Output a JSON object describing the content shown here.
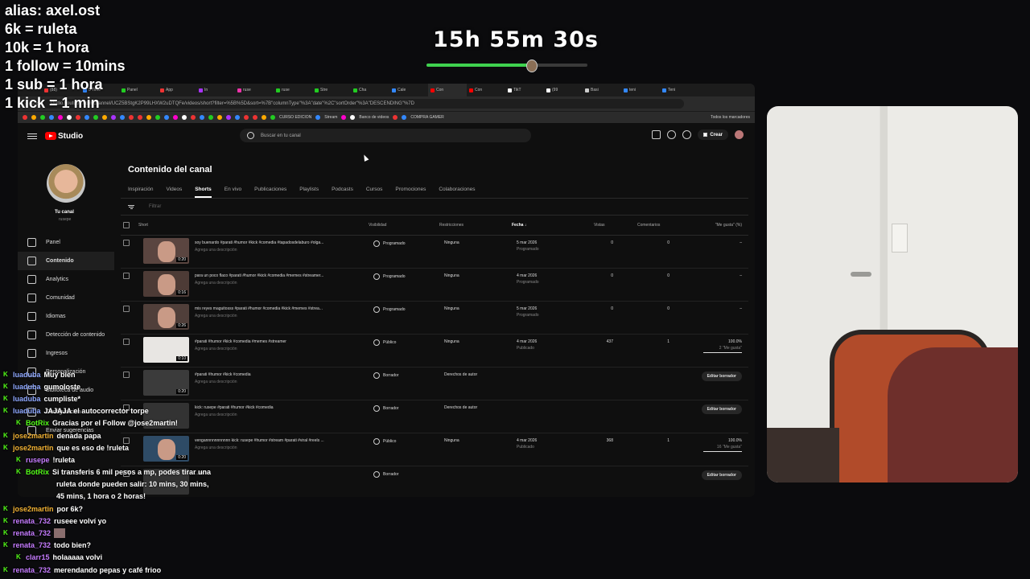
{
  "overlay": {
    "lines": [
      "alias: axel.ost",
      "6k =  ruleta",
      "10k = 1 hora",
      "1 follow = 10mins",
      "1 sub = 1 hora",
      "1 kick = 1 min"
    ],
    "timer": "15h 55m 30s",
    "timer_progress": 0.65
  },
  "browser": {
    "url": "studio.youtube.com/channel/UCZ5BStgK2P99LHXW2uDTQFe/videos/short?filter=%5B%5D&sort=%7B\"columnType\"%3A\"date\"%2C\"sortOrder\"%3A\"DESCENDING\"%7D",
    "tabs": [
      "(88)",
      "5 Time",
      "Panel",
      "App",
      "In",
      "ruse",
      "ruse",
      "Stre",
      "Cha",
      "Cale",
      "Con",
      "Con",
      "TikT",
      "(99",
      "Basi",
      "teni",
      "Teni"
    ],
    "bookmarks": [
      "CURSO EDICION",
      "Stream",
      "Banco de videos",
      "COMPRA GAMER",
      "Todos los marcadores"
    ]
  },
  "studio": {
    "brand": "Studio",
    "search_placeholder": "Buscar en tu canal",
    "create_label": "Crear",
    "channel_label": "Tu canal",
    "channel_handle": "rusepe",
    "nav": [
      "Panel",
      "Contenido",
      "Analytics",
      "Comunidad",
      "Idiomas",
      "Detección de contenido",
      "Ingresos",
      "Personalización",
      "Biblioteca de audio"
    ],
    "nav_bottom": [
      "Configuración",
      "Enviar sugerencias"
    ],
    "page_title": "Contenido del canal",
    "tabs": [
      "Inspiración",
      "Videos",
      "Shorts",
      "En vivo",
      "Publicaciones",
      "Playlists",
      "Podcasts",
      "Cursos",
      "Promociones",
      "Colaboraciones"
    ],
    "filter_placeholder": "Filtrar",
    "columns": {
      "short": "Short",
      "visibility": "Visibilidad",
      "restrictions": "Restricciones",
      "date": "Fecha",
      "views": "Vistas",
      "comments": "Comentarios",
      "likes": "\"Me gusta\" (%)"
    },
    "rows": [
      {
        "title": "soy buenardo #parati #humor #kick #comedia #tapadosdelaburo #olga...",
        "desc": "Agrega una descripción",
        "duration": "0:20",
        "visibility": "Programado",
        "restrictions": "Ninguna",
        "date": "5 mar 2026",
        "date_sub": "Programado",
        "views": "0",
        "comments": "0",
        "likes": "–",
        "likes_sub": ""
      },
      {
        "title": "para un poco flaco #parati #humor #kick #comedia #memes #streamer...",
        "desc": "Agrega una descripción",
        "duration": "0:16",
        "visibility": "Programado",
        "restrictions": "Ninguna",
        "date": "4 mar 2026",
        "date_sub": "Programado",
        "views": "0",
        "comments": "0",
        "likes": "–",
        "likes_sub": ""
      },
      {
        "title": "mis reyes maguitosss #parati #humor #comedia #kick #memes #strea...",
        "desc": "Agrega una descripción",
        "duration": "0:26",
        "visibility": "Programado",
        "restrictions": "Ninguna",
        "date": "5 mar 2026",
        "date_sub": "Programado",
        "views": "0",
        "comments": "0",
        "likes": "–",
        "likes_sub": ""
      },
      {
        "title": "#parati #humor #kick #comedia #memes #streamer",
        "desc": "Agrega una descripción",
        "duration": "0:10",
        "visibility": "Público",
        "restrictions": "Ninguna",
        "date": "4 mar 2026",
        "date_sub": "Publicado",
        "views": "437",
        "comments": "1",
        "likes": "100.0%",
        "likes_sub": "2 \"Me gusta\""
      },
      {
        "title": "#parati #humor #kick #comedia",
        "desc": "Agrega una descripción",
        "duration": "0:20",
        "visibility": "Borrador",
        "restrictions": "Derechos de autor",
        "date": "",
        "date_sub": "",
        "views": "",
        "comments": "",
        "likes": "",
        "likes_sub": "",
        "edit": "Editar borrador"
      },
      {
        "title": "kick: rusepe #parati #humor #kick #comedia",
        "desc": "Agrega una descripción",
        "duration": "",
        "visibility": "Borrador",
        "restrictions": "Derechos de autor",
        "date": "",
        "date_sub": "",
        "views": "",
        "comments": "",
        "likes": "",
        "likes_sub": "",
        "edit": "Editar borrador"
      },
      {
        "title": "vengannnnnnnnnnn kick: rusepe #humor #stream #parati #viral #reels ...",
        "desc": "Agrega una descripción",
        "duration": "0:20",
        "visibility": "Público",
        "restrictions": "Ninguna",
        "date": "4 mar 2026",
        "date_sub": "Publicado",
        "views": "368",
        "comments": "1",
        "likes": "100.0%",
        "likes_sub": "16 \"Me gusta\""
      },
      {
        "title": "...zle",
        "desc": "",
        "duration": "",
        "visibility": "Borrador",
        "restrictions": "",
        "date": "",
        "date_sub": "",
        "views": "",
        "comments": "",
        "likes": "",
        "likes_sub": "",
        "edit": "Editar borrador"
      }
    ]
  },
  "chat": [
    {
      "user": "luaduba",
      "color": "#8fa8ff",
      "text": "Muy bien"
    },
    {
      "user": "luaduba",
      "color": "#8fa8ff",
      "text": "gumoloste"
    },
    {
      "user": "luaduba",
      "color": "#8fa8ff",
      "text": "cumpliste*"
    },
    {
      "user": "luaduba",
      "color": "#8fa8ff",
      "text": "JAJAJA el autocorrector torpe"
    },
    {
      "user": "BotRix",
      "color": "#53fc18",
      "text": "Gracias por el Follow @jose2martin!"
    },
    {
      "user": "jose2martin",
      "color": "#f2b233",
      "text": "denada papa"
    },
    {
      "user": "jose2martin",
      "color": "#f2b233",
      "text": "que es eso de !ruleta"
    },
    {
      "user": "rusepe",
      "color": "#c67cff",
      "text": "!ruleta"
    },
    {
      "user": "BotRix",
      "color": "#53fc18",
      "text": "Si transferis 6 mil pesos a mp, podes tirar una"
    },
    {
      "user": "",
      "color": "#ffffff",
      "text": "ruleta donde pueden salir: 10 mins, 30 mins,"
    },
    {
      "user": "",
      "color": "#ffffff",
      "text": "45 mins, 1 hora o 2 horas!"
    },
    {
      "user": "jose2martin",
      "color": "#f2b233",
      "text": "por 6k?"
    },
    {
      "user": "renata_732",
      "color": "#c67cff",
      "text": "ruseee volví yo"
    },
    {
      "user": "renata_732",
      "color": "#c67cff",
      "text": ""
    },
    {
      "user": "renata_732",
      "color": "#c67cff",
      "text": "todo bien?"
    },
    {
      "user": "clarr15",
      "color": "#c67cff",
      "text": "holaaaaa volvi"
    },
    {
      "user": "renata_732",
      "color": "#c67cff",
      "text": "merendando pepas y café frioo"
    }
  ]
}
